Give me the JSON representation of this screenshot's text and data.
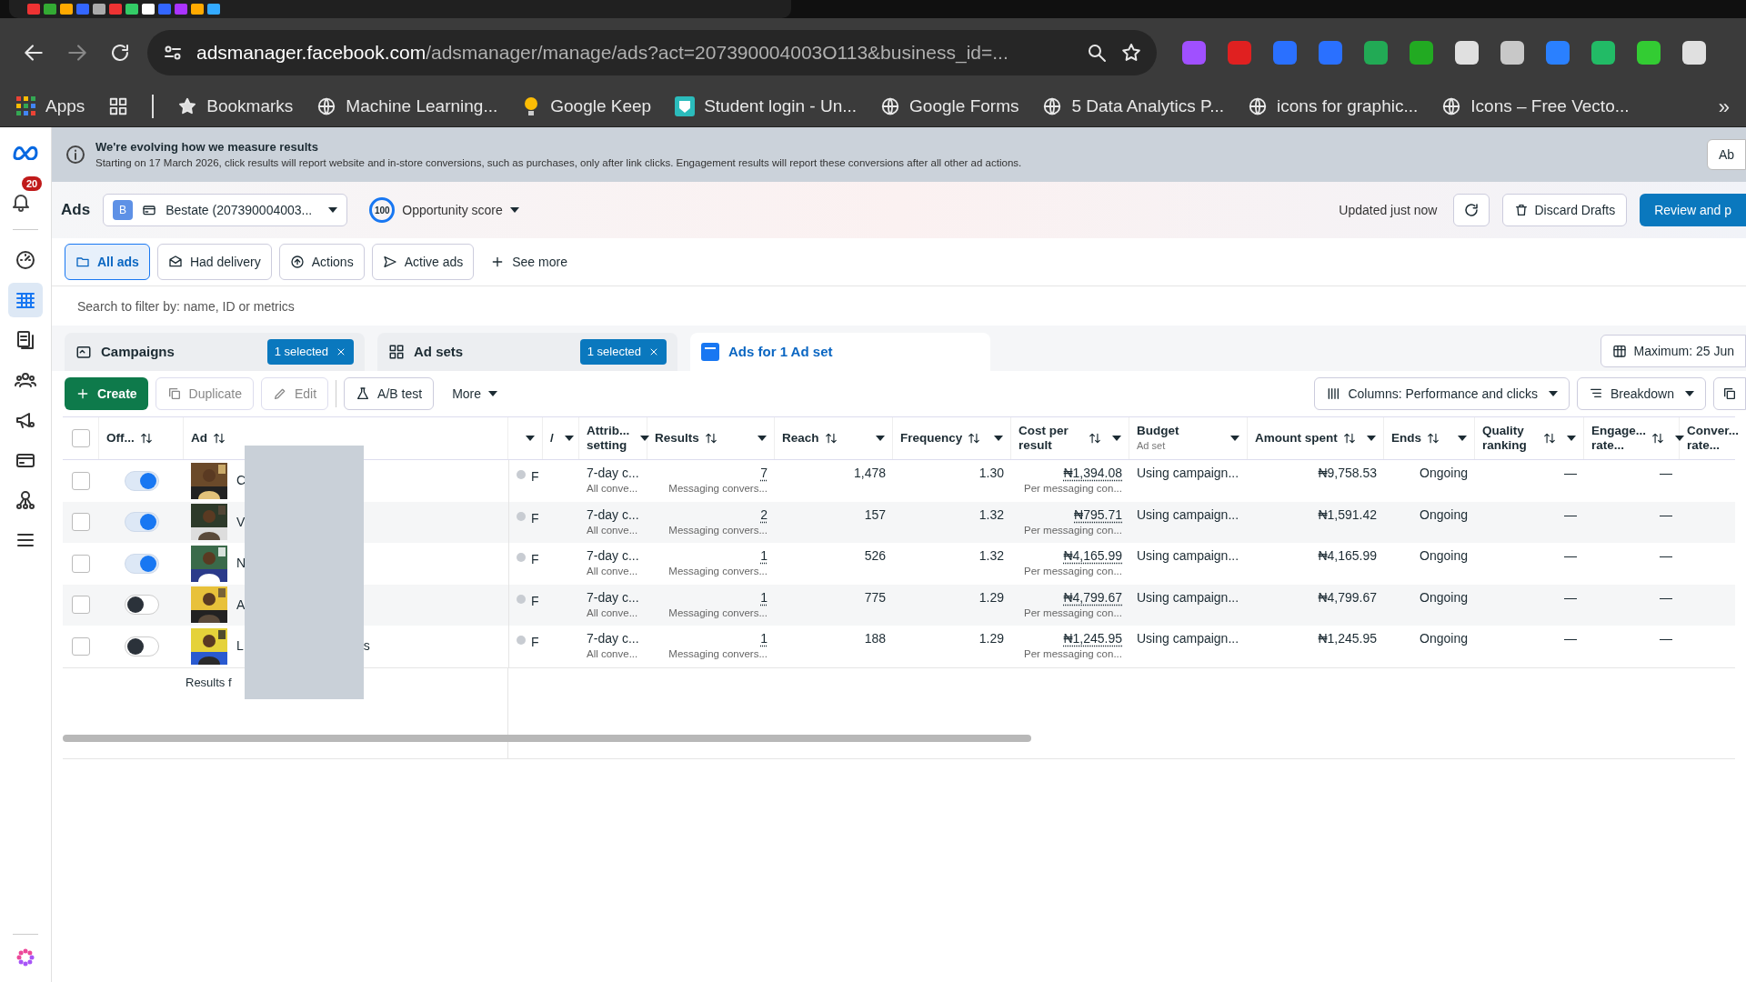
{
  "browser": {
    "url_host": "adsmanager.facebook.com",
    "url_path": "/adsmanager/manage/ads?act=207390004003O113&business_id=...",
    "bookmarks": [
      {
        "label": "Apps",
        "kind": "apps"
      },
      {
        "label": "Bookmarks",
        "kind": "star"
      },
      {
        "label": "Machine Learning...",
        "kind": "globe"
      },
      {
        "label": "Google Keep",
        "kind": "bulb"
      },
      {
        "label": "Student login - Un...",
        "kind": "shield"
      },
      {
        "label": "Google Forms",
        "kind": "globe"
      },
      {
        "label": "5 Data Analytics P...",
        "kind": "globe"
      },
      {
        "label": "icons for graphic...",
        "kind": "globe"
      },
      {
        "label": "Icons – Free Vecto...",
        "kind": "globe"
      }
    ],
    "more": "»"
  },
  "sidebar": {
    "notifications": "20",
    "items": [
      {
        "kind": "gauge",
        "selected": false
      },
      {
        "kind": "table",
        "selected": true
      },
      {
        "kind": "pages",
        "selected": false
      },
      {
        "kind": "people",
        "selected": false
      },
      {
        "kind": "megaphone",
        "selected": false
      },
      {
        "kind": "card",
        "selected": false
      },
      {
        "kind": "network",
        "selected": false
      },
      {
        "kind": "menu",
        "selected": false
      }
    ]
  },
  "banner": {
    "title": "We're evolving how we measure results",
    "text": "Starting on 17 March 2026, click results will report website and in-store conversions, such as purchases, only after link clicks. Engagement results will report these conversions after all other ad actions.",
    "button": "Ab"
  },
  "header": {
    "title": "Ads",
    "account_badge": "B",
    "account": "Bestate (207390004003...",
    "score": "100",
    "score_label": "Opportunity score",
    "updated": "Updated just now",
    "discard": "Discard Drafts",
    "review": "Review and p"
  },
  "filters": [
    {
      "label": "All ads",
      "selected": true
    },
    {
      "label": "Had delivery",
      "selected": false
    },
    {
      "label": "Actions",
      "selected": false
    },
    {
      "label": "Active ads",
      "selected": false
    }
  ],
  "see_more": "See more",
  "search": {
    "placeholder": "Search to filter by: name, ID or metrics"
  },
  "levels": [
    {
      "label": "Campaigns",
      "badge": "1 selected",
      "selected": false
    },
    {
      "label": "Ad sets",
      "badge": "1 selected",
      "selected": false
    },
    {
      "label": "Ads for 1 Ad set",
      "selected": true
    }
  ],
  "date_range": "Maximum: 25 Jun",
  "toolbar": {
    "create": "Create",
    "duplicate": "Duplicate",
    "edit": "Edit",
    "ab_test": "A/B test",
    "more": "More",
    "columns": "Columns: Performance and clicks",
    "breakdown": "Breakdown"
  },
  "table": {
    "select_all_checked": false,
    "columns": [
      {
        "label": "Off...",
        "sort": true
      },
      {
        "label": "Ad",
        "sort": true
      },
      {
        "sort": false
      },
      {
        "label": "/",
        "sort": false
      },
      {
        "label": "Attrib... setting",
        "sort": false
      },
      {
        "label": "Results",
        "sort": true
      },
      {
        "label": "Reach",
        "sort": true
      },
      {
        "label": "Frequency",
        "sort": true
      },
      {
        "label": "Cost per result",
        "sort": true
      },
      {
        "label": "Budget",
        "sub": "Ad set",
        "sort": false
      },
      {
        "label": "Amount spent",
        "sort": true
      },
      {
        "label": "Ends",
        "sort": true
      },
      {
        "label": "Quality ranking",
        "sort": true
      },
      {
        "label": "Engage... rate...",
        "sort": true
      },
      {
        "label": "Conver... rate...",
        "sort": false
      }
    ],
    "rows": [
      {
        "checked": false,
        "on": true,
        "name": "C",
        "status": "F",
        "attribution": "7-day c...",
        "attribution_sub": "All conve...",
        "results": "7",
        "results_sub": "Messaging convers...",
        "reach": "1,478",
        "frequency": "1.30",
        "cost": "₦1,394.08",
        "cost_sub": "Per messaging con...",
        "budget": "Using campaign...",
        "spent": "₦9,758.53",
        "ends": "Ongoing",
        "quality": "—",
        "engagement": "—"
      },
      {
        "checked": false,
        "on": true,
        "name": "V",
        "status": "F",
        "attribution": "7-day c...",
        "attribution_sub": "All conve...",
        "results": "2",
        "results_sub": "Messaging convers...",
        "reach": "157",
        "frequency": "1.32",
        "cost": "₦795.71",
        "cost_sub": "Per messaging con...",
        "budget": "Using campaign...",
        "spent": "₦1,591.42",
        "ends": "Ongoing",
        "quality": "—",
        "engagement": "—"
      },
      {
        "checked": false,
        "on": true,
        "name": "N",
        "status": "F",
        "attribution": "7-day c...",
        "attribution_sub": "All conve...",
        "results": "1",
        "results_sub": "Messaging convers...",
        "reach": "526",
        "frequency": "1.32",
        "cost": "₦4,165.99",
        "cost_sub": "Per messaging con...",
        "budget": "Using campaign...",
        "spent": "₦4,165.99",
        "ends": "Ongoing",
        "quality": "—",
        "engagement": "—"
      },
      {
        "checked": false,
        "on": false,
        "name": "A",
        "status": "F",
        "attribution": "7-day c...",
        "attribution_sub": "All conve...",
        "results": "1",
        "results_sub": "Messaging convers...",
        "reach": "775",
        "frequency": "1.29",
        "cost": "₦4,799.67",
        "cost_sub": "Per messaging con...",
        "budget": "Using campaign...",
        "spent": "₦4,799.67",
        "ends": "Ongoing",
        "quality": "—",
        "engagement": "—"
      },
      {
        "checked": false,
        "on": false,
        "name": "L",
        "name_tail": "s",
        "status": "F",
        "attribution": "7-day c...",
        "attribution_sub": "All conve...",
        "results": "1",
        "results_sub": "Messaging convers...",
        "reach": "188",
        "frequency": "1.29",
        "cost": "₦1,245.95",
        "cost_sub": "Per messaging con...",
        "budget": "Using campaign...",
        "spent": "₦1,245.95",
        "ends": "Ongoing",
        "quality": "—",
        "engagement": "—"
      }
    ],
    "footer": "Results f"
  }
}
